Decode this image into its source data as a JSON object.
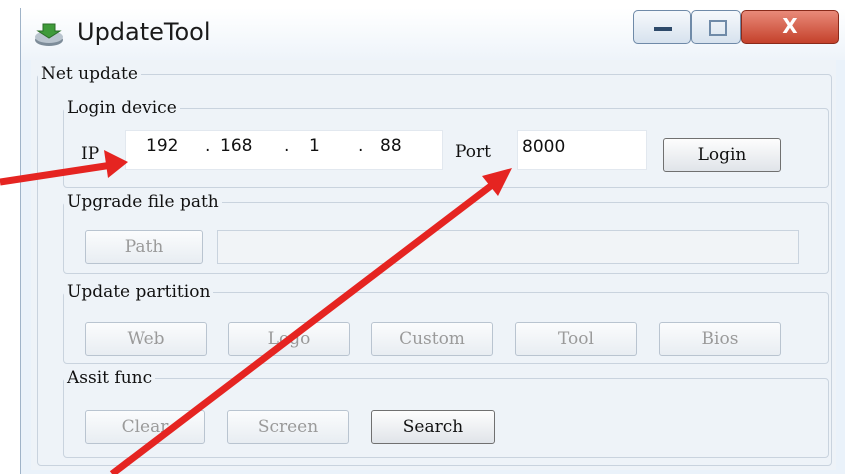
{
  "window": {
    "title": "UpdateTool",
    "close_glyph": "X"
  },
  "net_update": {
    "legend": "Net update",
    "login_device": {
      "legend": "Login device",
      "ip_label": "IP",
      "ip": [
        "192",
        "168",
        "1",
        "88"
      ],
      "ip_dots": [
        ".",
        ".",
        "."
      ],
      "port_label": "Port",
      "port_value": "8000",
      "login_button": "Login"
    },
    "upgrade_file_path": {
      "legend": "Upgrade file path",
      "path_button": "Path",
      "path_value": ""
    },
    "update_partition": {
      "legend": "Update partition",
      "buttons": [
        "Web",
        "Logo",
        "Custom",
        "Tool",
        "Bios"
      ]
    },
    "assit_func": {
      "legend": "Assit func",
      "buttons": [
        "Clear",
        "Screen",
        "Search"
      ]
    }
  },
  "colors": {
    "arrow": "#e52421",
    "close_button": "#c4412b",
    "window_bg": "#eaf2fa"
  },
  "icons": [
    "app-icon",
    "minimize-icon",
    "maximize-icon",
    "close-icon"
  ]
}
